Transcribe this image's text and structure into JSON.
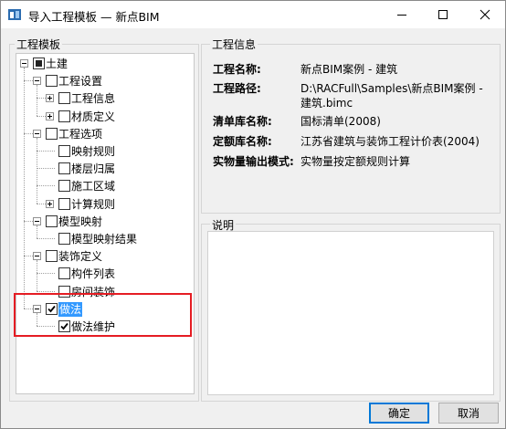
{
  "window": {
    "title": "导入工程模板 — 新点BIM"
  },
  "template_group": {
    "label": "工程模板"
  },
  "tree": {
    "nodes": [
      {
        "label": "土建",
        "state": "partial",
        "expanded": true
      },
      {
        "label": "工程设置",
        "state": "unchecked",
        "expanded": true
      },
      {
        "label": "工程信息",
        "state": "unchecked",
        "expanded": false
      },
      {
        "label": "材质定义",
        "state": "unchecked",
        "expanded": false
      },
      {
        "label": "工程选项",
        "state": "unchecked",
        "expanded": true
      },
      {
        "label": "映射规则",
        "state": "unchecked"
      },
      {
        "label": "楼层归属",
        "state": "unchecked"
      },
      {
        "label": "施工区域",
        "state": "unchecked"
      },
      {
        "label": "计算规则",
        "state": "unchecked",
        "expanded": false
      },
      {
        "label": "模型映射",
        "state": "unchecked",
        "expanded": true
      },
      {
        "label": "模型映射结果",
        "state": "unchecked"
      },
      {
        "label": "装饰定义",
        "state": "unchecked",
        "expanded": true
      },
      {
        "label": "构件列表",
        "state": "unchecked"
      },
      {
        "label": "房间装饰",
        "state": "unchecked"
      },
      {
        "label": "做法",
        "state": "checked",
        "expanded": true,
        "selected": true
      },
      {
        "label": "做法维护",
        "state": "checked"
      }
    ]
  },
  "info_group": {
    "label": "工程信息",
    "rows": [
      {
        "key": "工程名称:",
        "value": "新点BIM案例 - 建筑"
      },
      {
        "key": "工程路径:",
        "value": "D:\\RACFull\\Samples\\新点BIM案例 -",
        "value2": "建筑.bimc"
      },
      {
        "key": "清单库名称:",
        "value": "国标清单(2008)"
      },
      {
        "key": "定额库名称:",
        "value": "江苏省建筑与装饰工程计价表(2004)"
      },
      {
        "key": "实物量输出模式:",
        "value": "实物量按定额规则计算"
      }
    ]
  },
  "desc_group": {
    "label": "说明"
  },
  "buttons": {
    "ok": "确定",
    "cancel": "取消"
  },
  "colors": {
    "highlight_border": "#e51c23",
    "selection": "#3399ff",
    "default_button_border": "#0078d7"
  }
}
